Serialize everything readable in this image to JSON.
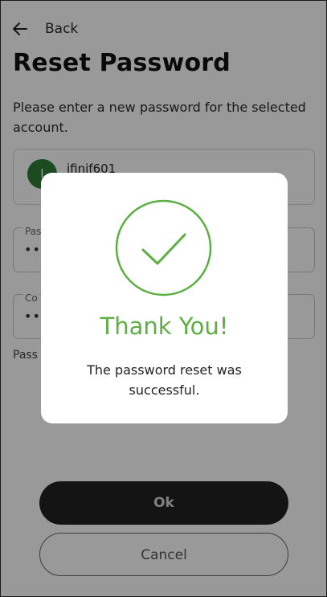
{
  "header": {
    "back_label": "Back",
    "title": "Reset Password",
    "description": "Please enter a new password for the selected account."
  },
  "account": {
    "avatar_initial": "I",
    "username": "ifinif601"
  },
  "fields": {
    "password": {
      "label": "Pas",
      "value": "•••"
    },
    "confirm": {
      "label": "Co",
      "value": "•••"
    },
    "hint": "Pass"
  },
  "actions": {
    "ok_label": "Ok",
    "cancel_label": "Cancel"
  },
  "dialog": {
    "title": "Thank You!",
    "message": "The password reset was successful.",
    "icon": "checkmark-circle-icon",
    "accent_color": "#5cb043"
  }
}
